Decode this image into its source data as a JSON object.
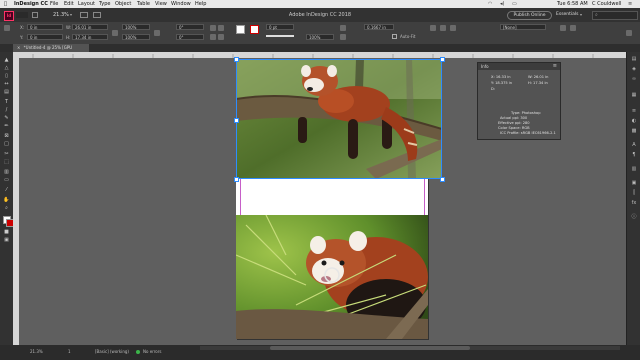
{
  "menubar": {
    "apple": "",
    "app": "InDesign CC",
    "items": [
      "File",
      "Edit",
      "Layout",
      "Type",
      "Object",
      "Table",
      "View",
      "Window",
      "Help"
    ],
    "clock": "Tue 6:58 AM",
    "user": "C Couldwell"
  },
  "appbar": {
    "logo": "Id",
    "zoom": "21.3%",
    "title": "Adobe InDesign CC 2018",
    "publish": "Publish Online",
    "workspace": "Essentials",
    "search_placeholder": ""
  },
  "control": {
    "x_label": "X:",
    "y_label": "Y:",
    "x_value": "0 in",
    "y_value": "0 in",
    "w_label": "W:",
    "h_label": "H:",
    "w_value": "26.01 in",
    "h_value": "17.34 in",
    "scale_x": "100%",
    "scale_y": "100%",
    "angle": "0°",
    "shear": "0°",
    "stroke_weight": "0 pt",
    "opacity": "100%",
    "offset": "0.1667 in",
    "autofit": "Auto-Fit",
    "style": "[None]"
  },
  "doctab": {
    "label": "*Untitled-4 @ 25% [GPU Preview]",
    "close": "×"
  },
  "info_panel": {
    "tab": "Info",
    "x": "X: 16.33 in",
    "y": "Y: 18.375 in",
    "w": "W: 26.01 in",
    "h": "H: 17.34 in",
    "d": "D:",
    "type": "Type: Photoshop",
    "actual_ppi": "Actual ppi: 300",
    "effective_ppi": "Effective ppi: 280",
    "color_space": "Color Space: RGB",
    "icc": "ICC Profile: sRGB IEC61966-2.1"
  },
  "status": {
    "zoom": "21.3%",
    "page": "1",
    "style": "[Basic] (working)",
    "preflight": "No errors"
  },
  "colors": {
    "accent": "#2d8cff",
    "pasteboard": "#5f5f5f",
    "panel": "#323232",
    "ok_green": "#3bb54a"
  }
}
